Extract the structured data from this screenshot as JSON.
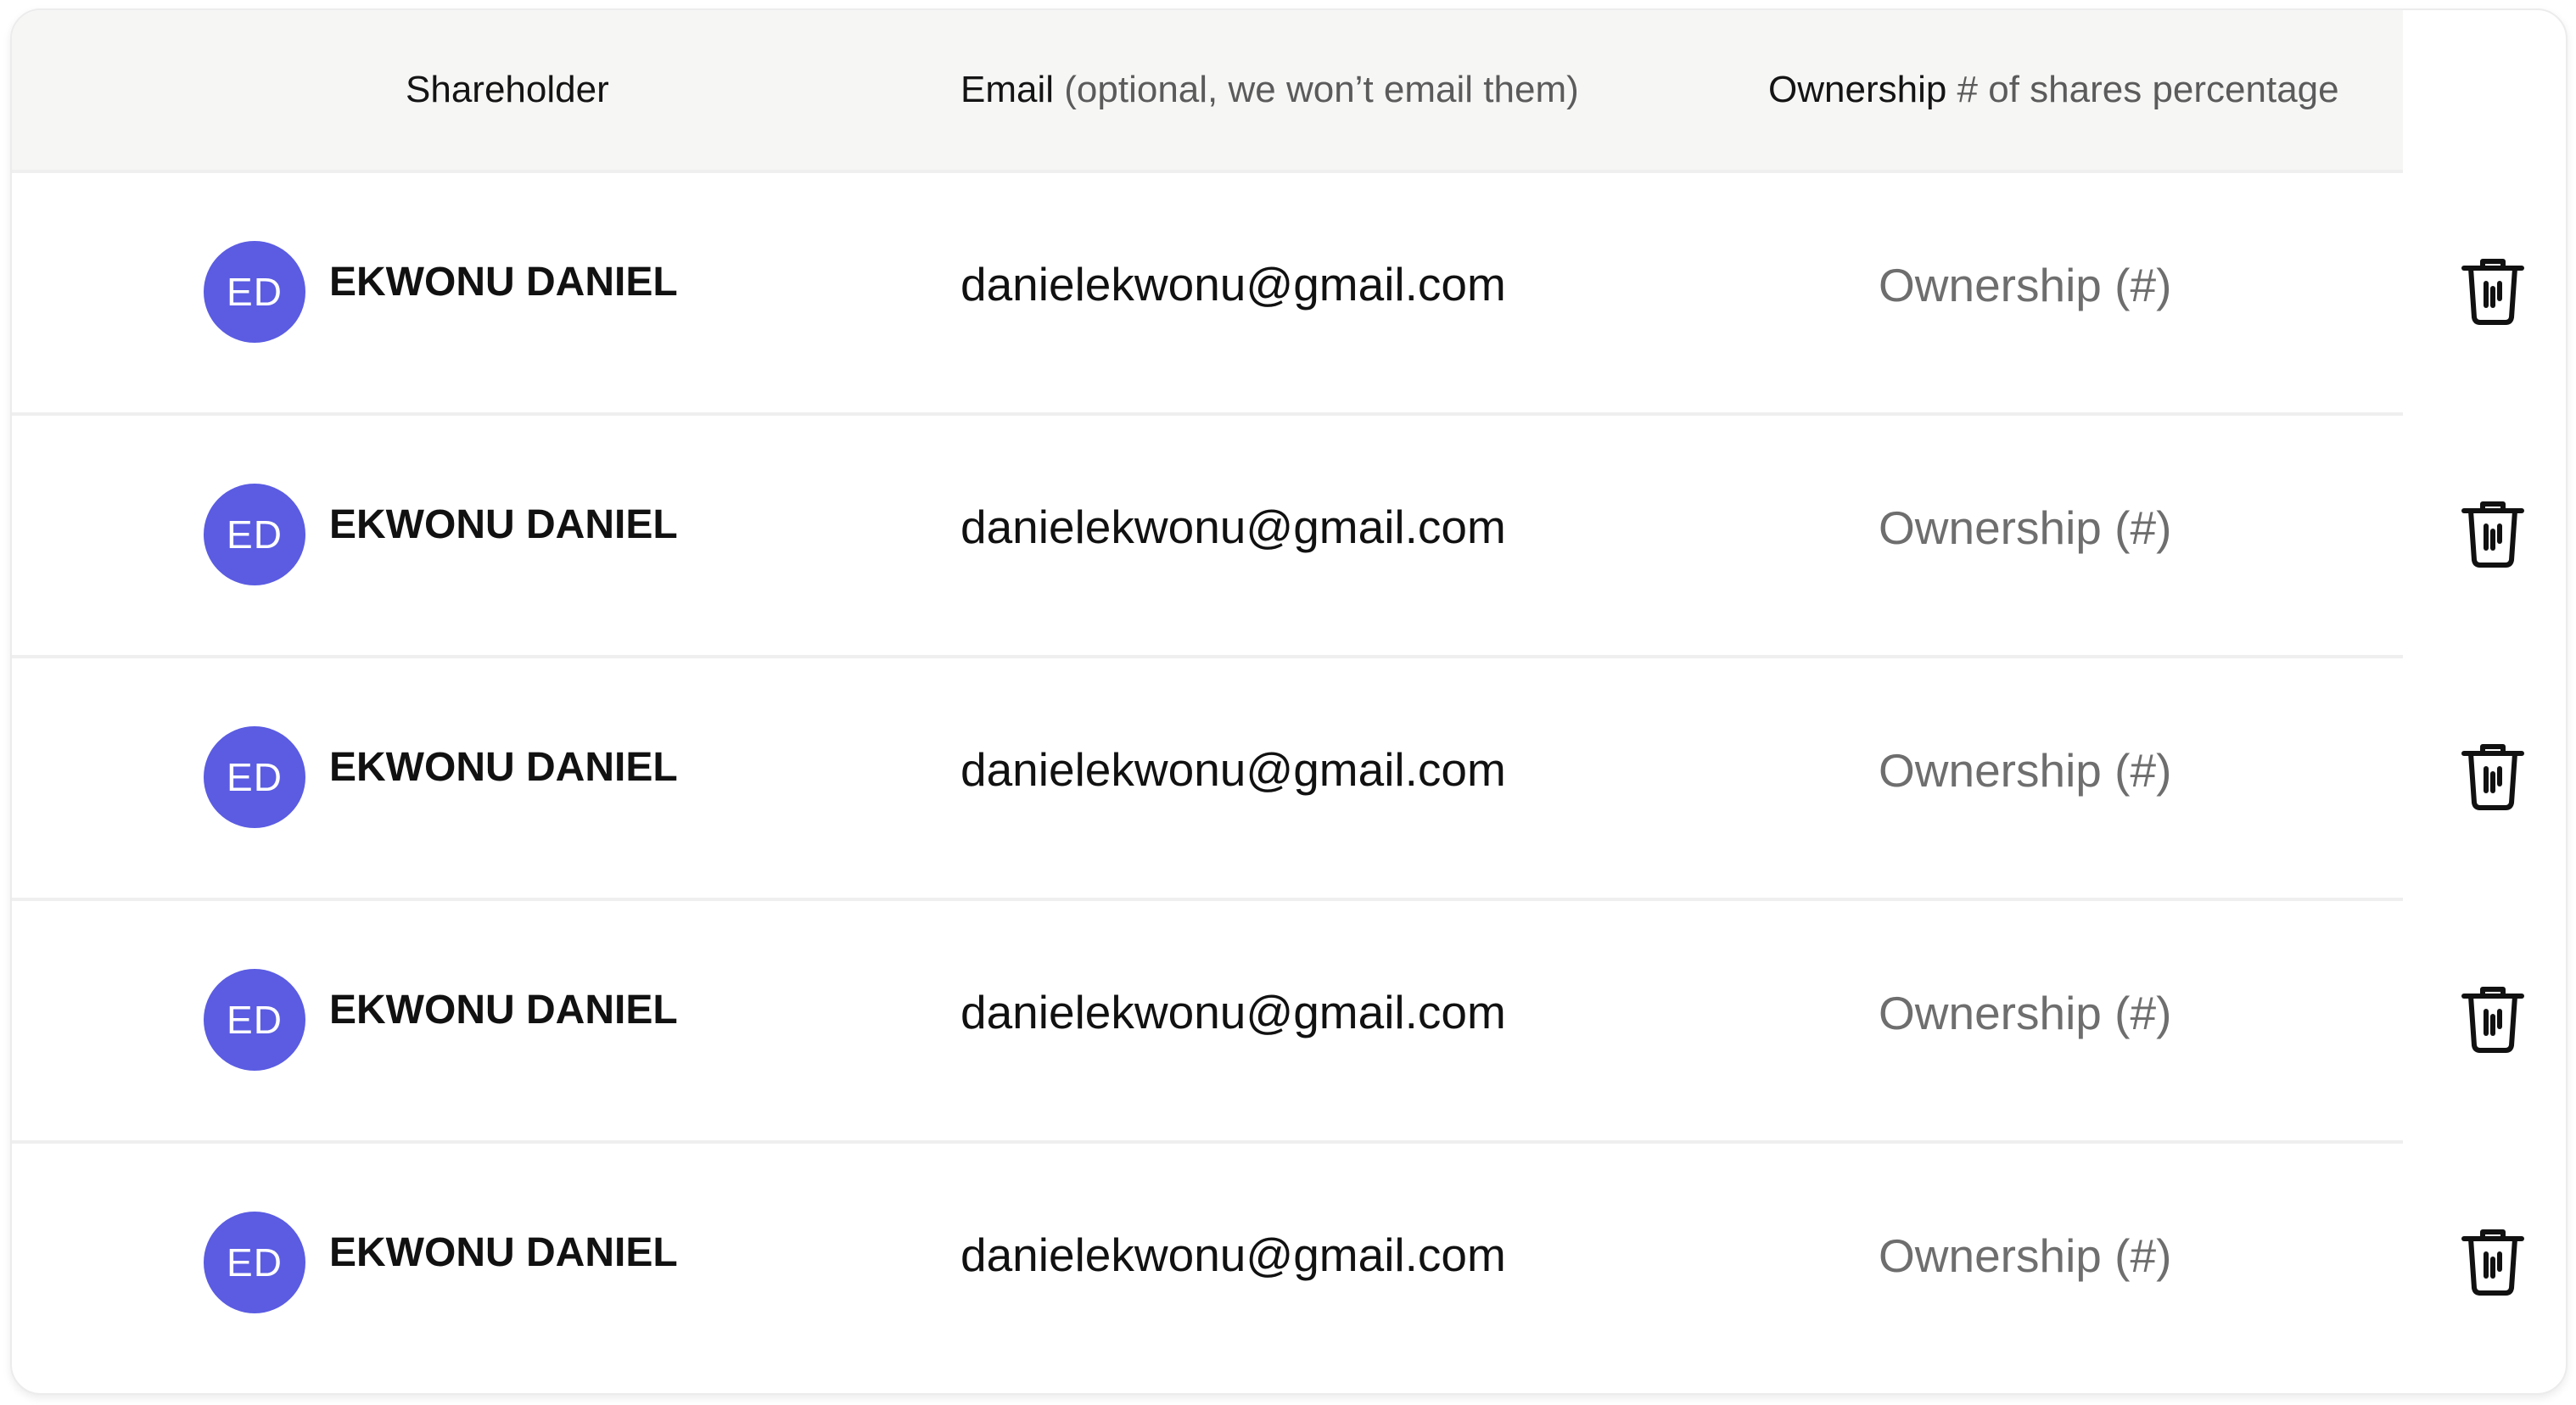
{
  "header": {
    "shareholder": "Shareholder",
    "email_strong": "Email",
    "email_muted": "(optional, we won’t email them)",
    "ownership_strong": "Ownership",
    "ownership_muted": "# of shares percentage"
  },
  "rows": [
    {
      "initials": "ED",
      "name": "EKWONU DANIEL",
      "email": "danielekwonu@gmail.com",
      "ownership_value": "",
      "ownership_placeholder": "Ownership (#)"
    },
    {
      "initials": "ED",
      "name": "EKWONU DANIEL",
      "email": "danielekwonu@gmail.com",
      "ownership_value": "",
      "ownership_placeholder": "Ownership (#)"
    },
    {
      "initials": "ED",
      "name": "EKWONU DANIEL",
      "email": "danielekwonu@gmail.com",
      "ownership_value": "",
      "ownership_placeholder": "Ownership (#)"
    },
    {
      "initials": "ED",
      "name": "EKWONU DANIEL",
      "email": "danielekwonu@gmail.com",
      "ownership_value": "",
      "ownership_placeholder": "Ownership (#)"
    },
    {
      "initials": "ED",
      "name": "EKWONU DANIEL",
      "email": "danielekwonu@gmail.com",
      "ownership_value": "",
      "ownership_placeholder": "Ownership (#)"
    }
  ],
  "icons": {
    "delete": "trash-icon"
  },
  "colors": {
    "avatar": "#5b5ce2",
    "header_bg": "#f6f7f5"
  }
}
